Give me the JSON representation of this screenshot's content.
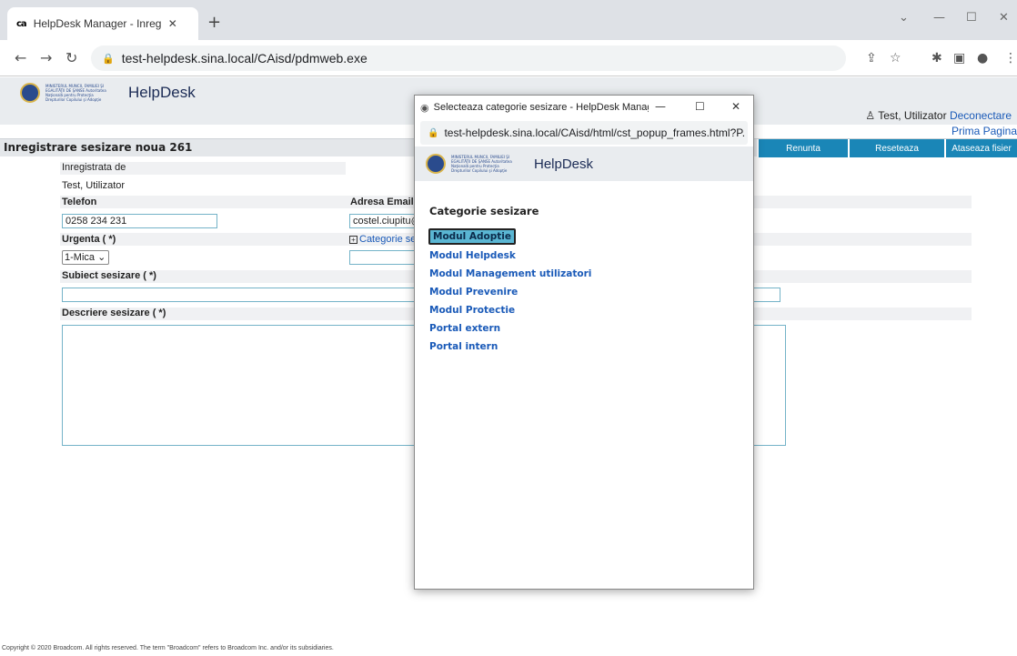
{
  "browser": {
    "tab_icon": "ca",
    "tab_title": "HelpDesk Manager - Inregistrare",
    "url": "test-helpdesk.sina.local/CAisd/pdmweb.exe"
  },
  "app": {
    "ministry_text": "MINISTERUL MUNCII, FAMILIEI ŞI EGALITĂŢII DE ŞANSE Autoritatea Naţională pentru Protecţia Drepturilor Copilului şi Adopţie",
    "brand": "HelpDesk",
    "user_name": "Test, Utilizator",
    "logout": "Deconectare",
    "home": "Prima Pagina",
    "page_title": "Inregistrare sesizare noua 261",
    "buttons": {
      "cancel": "Renunta",
      "reset": "Reseteaza",
      "attach": "Ataseaza fisier"
    }
  },
  "form": {
    "registered_by_label": "Inregistrata de",
    "registered_by_value": "Test, Utilizator",
    "phone_label": "Telefon",
    "phone_value": "0258 234 231",
    "email_label": "Adresa Email",
    "email_value": "costel.ciupitu@",
    "urgency_label": "Urgenta ( *)",
    "urgency_value": "1-Mica",
    "category_label": "Categorie se",
    "subject_label": "Subiect sesizare ( *)",
    "subject_value": "",
    "description_label": "Descriere sesizare ( *)",
    "description_value": ""
  },
  "footer": "Copyright © 2020 Broadcom. All rights reserved. The term \"Broadcom\" refers to Broadcom Inc. and/or its subsidiaries.",
  "popup": {
    "title": "Selecteaza categorie sesizare - HelpDesk Manager...",
    "url": "test-helpdesk.sina.local/CAisd/html/cst_popup_frames.html?P...",
    "heading": "Categorie sesizare",
    "categories": [
      "Modul Adoptie",
      "Modul Helpdesk",
      "Modul Management utilizatori",
      "Modul Prevenire",
      "Modul Protectie",
      "Portal extern",
      "Portal intern"
    ],
    "selected_index": 0
  },
  "colors": {
    "accent": "#1a86b7",
    "link": "#1a5ab8",
    "selected": "#5ab6d3"
  }
}
